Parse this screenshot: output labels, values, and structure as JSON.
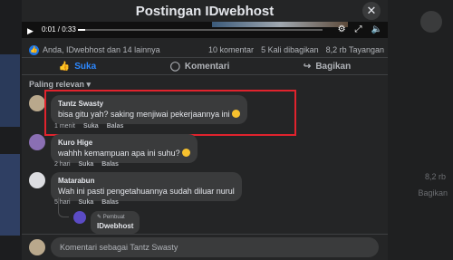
{
  "modal": {
    "title": "Postingan IDwebhost",
    "close_icon": "close-icon"
  },
  "video": {
    "time": "0:01 / 0:33",
    "progress": 0.03
  },
  "stats": {
    "reactions": "Anda, IDwebhost dan 14 lainnya",
    "comments": "10 komentar",
    "shares": "5 Kali dibagikan",
    "views": "8,2 rb Tayangan"
  },
  "actions": {
    "like": "Suka",
    "comment": "Komentari",
    "share": "Bagikan"
  },
  "sort_label": "Paling relevan",
  "comments": [
    {
      "author": "Tantz Swasty",
      "text": "bisa gitu yah? saking menjiwai pekerjaannya ini",
      "time": "1 menit",
      "like": "Suka",
      "reply": "Balas"
    },
    {
      "author": "Kuro Hige",
      "text": "wahhh kemampuan apa ini suhu?",
      "time": "2 hari",
      "like": "Suka",
      "reply": "Balas"
    },
    {
      "author": "Matarabun",
      "text": "Wah ini pasti pengetahuannya sudah diluar nurul",
      "time": "5 hari",
      "like": "Suka",
      "reply": "Balas"
    }
  ],
  "reply": {
    "tag": "Pembuat",
    "author": "IDwebhost"
  },
  "compose": {
    "placeholder": "Komentari sebagai Tantz Swasty"
  },
  "background": {
    "right_stat": "8,2 rb",
    "right_action": "Bagikan"
  },
  "colors": {
    "accent": "#2d88ff",
    "highlight": "#e0232d",
    "bubble": "#3a3b3c"
  }
}
